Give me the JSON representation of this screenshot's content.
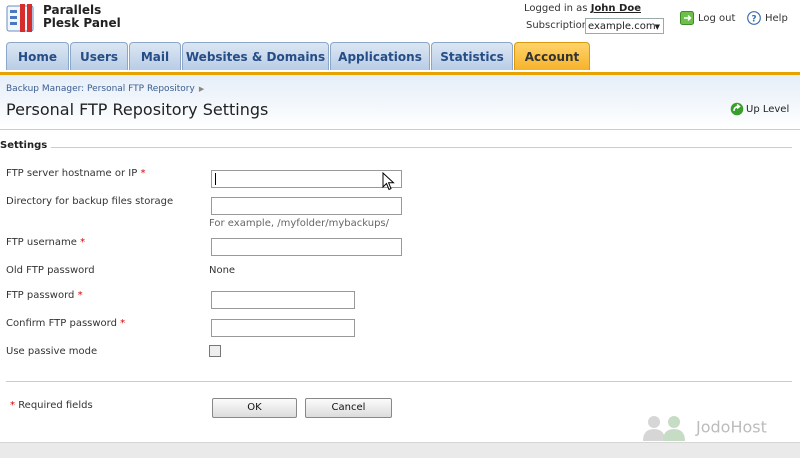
{
  "brand": {
    "line1": "Parallels",
    "line2": "Plesk Panel"
  },
  "account": {
    "logged_in_as": "Logged in as",
    "user_name": "John Doe",
    "subscription_label": "Subscription",
    "subscription_value": "example.com",
    "logout": "Log out",
    "help": "Help"
  },
  "tabs": [
    {
      "label": "Home"
    },
    {
      "label": "Users"
    },
    {
      "label": "Mail"
    },
    {
      "label": "Websites & Domains"
    },
    {
      "label": "Applications"
    },
    {
      "label": "Statistics"
    },
    {
      "label": "Account"
    }
  ],
  "breadcrumb": {
    "item": "Backup Manager: Personal FTP Repository"
  },
  "page": {
    "title": "Personal FTP Repository Settings",
    "up_level": "Up Level"
  },
  "form": {
    "section_title": "Settings",
    "hostname_label": "FTP server hostname or IP",
    "directory_label": "Directory for backup files storage",
    "directory_hint": "For example, /myfolder/mybackups/",
    "username_label": "FTP username",
    "old_password_label": "Old FTP password",
    "old_password_value": "None",
    "password_label": "FTP password",
    "confirm_password_label": "Confirm FTP password",
    "passive_label": "Use passive mode",
    "required_star": "*",
    "required_note": "Required fields",
    "ok_button": "OK",
    "cancel_button": "Cancel"
  },
  "watermark": "JodoHost",
  "colors": {
    "accent": "#f6b32a",
    "tab_blue": "#264d86",
    "required": "#dd0000"
  }
}
